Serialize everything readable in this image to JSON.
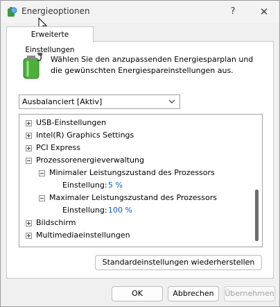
{
  "window": {
    "title": "Energieoptionen",
    "help_label": "?",
    "close_label": "✕"
  },
  "tab": {
    "label": "Erweiterte Einstellungen"
  },
  "description": "Wählen Sie den anzupassenden Energiesparplan und die gewünschten Energiespareinstellungen aus.",
  "plan_select": {
    "value": "Ausbalanciert [Aktiv]"
  },
  "tree": {
    "items": [
      {
        "label": "USB-Einstellungen"
      },
      {
        "label": "Intel(R) Graphics Settings"
      },
      {
        "label": "PCI Express"
      },
      {
        "label": "Prozessorenergieverwaltung"
      },
      {
        "label": "Minimaler Leistungszustand des Prozessors"
      },
      {
        "label": "Einstellung:",
        "value": "5 %"
      },
      {
        "label": "Maximaler Leistungszustand des Prozessors"
      },
      {
        "label": "Einstellung:",
        "value": "100 %"
      },
      {
        "label": "Bildschirm"
      },
      {
        "label": "Multimediaeinstellungen"
      }
    ]
  },
  "buttons": {
    "restore": "Standardeinstellungen wiederherstellen",
    "ok": "OK",
    "cancel": "Abbrechen",
    "apply": "Übernehmen"
  },
  "colors": {
    "value_blue": "#0a5fc8",
    "battery_green": "#4caf3a"
  }
}
